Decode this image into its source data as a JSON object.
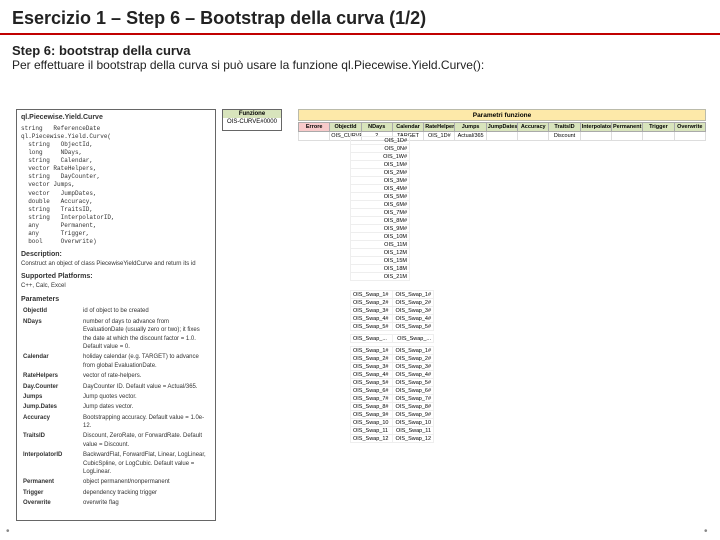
{
  "title": "Esercizio 1 – Step 6 – Bootstrap della curva (1/2)",
  "subtitle": "Step 6: bootstrap della curva",
  "bodytext": "Per effettuare il bootstrap della curva si può usare la funzione ql.Piecewise.Yield.Curve():",
  "leftpanel": {
    "header": "ql.Piecewise.Yield.Curve",
    "signature": [
      "string   ReferenceDate",
      "ql.Piecewise.Yield.Curve(",
      "  string   ObjectId,",
      "  long     NDays,",
      "  string   Calendar,",
      "  vector<string> RateHelpers,",
      "  string   DayCounter,",
      "  vector<string> Jumps,",
      "  vector<long>   JumpDates,",
      "  double   Accuracy,",
      "  string   TraitsID,",
      "  string   InterpolatorID,",
      "  any      Permanent,",
      "  any      Trigger,",
      "  bool     Overwrite)"
    ],
    "desc_label": "Description:",
    "desc_text": "Construct an object of class PiecewiseYieldCurve and return its id",
    "platforms_label": "Supported Platforms:",
    "platforms_text": "C++, Calc, Excel",
    "params_label": "Parameters",
    "params": [
      {
        "k": "ObjectId",
        "v": "id of object to be created"
      },
      {
        "k": "NDays",
        "v": "number of days to advance from EvaluationDate (usually zero or two); it fixes the date at which the discount factor = 1.0. Default value = 0."
      },
      {
        "k": "Calendar",
        "v": "holiday calendar (e.g. TARGET) to advance from global EvaluationDate."
      },
      {
        "k": "RateHelpers",
        "v": "vector of rate-helpers."
      },
      {
        "k": "Day.Counter",
        "v": "DayCounter ID. Default value = Actual/365."
      },
      {
        "k": "Jumps",
        "v": "Jump quotes vector."
      },
      {
        "k": "Jump.Dates",
        "v": "Jump dates vector."
      },
      {
        "k": "Accuracy",
        "v": "Bootstrapping accuracy. Default value = 1.0e-12."
      },
      {
        "k": "TraitsID",
        "v": "Discount, ZeroRate, or ForwardRate. Default value = Discount."
      },
      {
        "k": "InterpolatorID",
        "v": "BackwardFlat, ForwardFlat, Linear, LogLinear, CubicSpline, or LogCubic. Default value = LogLinear."
      },
      {
        "k": "Permanent",
        "v": "object permanent/nonpermanent"
      },
      {
        "k": "Trigger",
        "v": "dependency tracking trigger"
      },
      {
        "k": "Overwrite",
        "v": "overwrite flag"
      }
    ]
  },
  "mid": {
    "h": "Funzione",
    "v": "OIS-CURVE#0000"
  },
  "band": "Parametri funzione",
  "topheaders": [
    "Errore",
    "ObjectId",
    "NDays",
    "Calendar",
    "RateHelpers",
    "Jumps",
    "JumpDates",
    "Accuracy",
    "TraitsID",
    "InterpolatorID",
    "Permanent",
    "Trigger",
    "Overwrite"
  ],
  "toprow": [
    "",
    "OIS_CURVE",
    "2",
    "TARGET",
    "OIS_1D#",
    "Actual/365",
    "",
    "",
    "Discount",
    "",
    "",
    "",
    ""
  ],
  "rates": [
    "OIS_1D#",
    "OIS_0N#",
    "OIS_1W#",
    "OIS_1M#",
    "OIS_2M#",
    "OIS_3M#",
    "OIS_4M#",
    "OIS_5M#",
    "OIS_6M#",
    "OIS_7M#",
    "OIS_8M#",
    "OIS_9M#",
    "OIS_10M",
    "OIS_11M",
    "OIS_12M",
    "OIS_15M",
    "OIS_18M",
    "OIS_21M"
  ],
  "swaps1": [
    {
      "n": "OIS_Swap_1#",
      "v": "OIS_Swap_1#"
    },
    {
      "n": "OIS_Swap_2#",
      "v": "OIS_Swap_2#"
    },
    {
      "n": "OIS_Swap_3#",
      "v": "OIS_Swap_3#"
    },
    {
      "n": "OIS_Swap_4#",
      "v": "OIS_Swap_4#"
    },
    {
      "n": "OIS_Swap_5#",
      "v": "OIS_Swap_5#"
    }
  ],
  "swaps_mid": {
    "n": "OIS_Swap_...",
    "v": "OIS_Swap_..."
  },
  "swaps2": [
    {
      "n": "OIS_Swap_1#",
      "v": "OIS_Swap_1#"
    },
    {
      "n": "OIS_Swap_2#",
      "v": "OIS_Swap_2#"
    },
    {
      "n": "OIS_Swap_3#",
      "v": "OIS_Swap_3#"
    },
    {
      "n": "OIS_Swap_4#",
      "v": "OIS_Swap_4#"
    },
    {
      "n": "OIS_Swap_5#",
      "v": "OIS_Swap_5#"
    },
    {
      "n": "OIS_Swap_6#",
      "v": "OIS_Swap_6#"
    },
    {
      "n": "OIS_Swap_7#",
      "v": "OIS_Swap_7#"
    },
    {
      "n": "OIS_Swap_8#",
      "v": "OIS_Swap_8#"
    },
    {
      "n": "OIS_Swap_9#",
      "v": "OIS_Swap_9#"
    },
    {
      "n": "OIS_Swap_10",
      "v": "OIS_Swap_10"
    },
    {
      "n": "OIS_Swap_11",
      "v": "OIS_Swap_11"
    },
    {
      "n": "OIS_Swap_12",
      "v": "OIS_Swap_12"
    }
  ]
}
